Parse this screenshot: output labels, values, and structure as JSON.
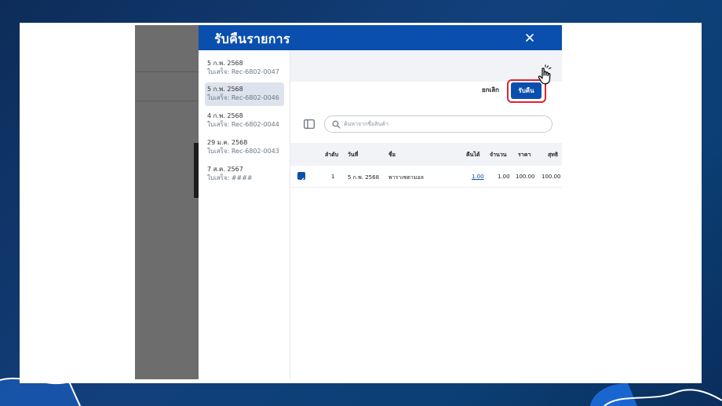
{
  "modal": {
    "title": "รับคืนรายการ"
  },
  "receipts": [
    {
      "date": "5 ก.พ. 2568",
      "receipt": "ใบเสร็จ: Rec-6802-0047",
      "selected": false
    },
    {
      "date": "5 ก.พ. 2568",
      "receipt": "ใบเสร็จ: Rec-6802-0046",
      "selected": true
    },
    {
      "date": "4 ก.พ. 2568",
      "receipt": "ใบเสร็จ: Rec-6802-0044",
      "selected": false
    },
    {
      "date": "29 ม.ค. 2568",
      "receipt": "ใบเสร็จ: Rec-6802-0043",
      "selected": false
    },
    {
      "date": "7 ส.ค. 2567",
      "receipt": "ใบเสร็จ: ####",
      "selected": false
    }
  ],
  "toolbar": {
    "cancel_label": "ยกเลิก",
    "confirm_label": "รับคืน"
  },
  "search": {
    "placeholder": "ค้นหาจากชื่อสินค้า"
  },
  "table": {
    "columns": [
      "ลำดับ",
      "วันที่",
      "ชื่อ",
      "คืนได้",
      "จำนวน",
      "ราคา",
      "สุทธิ"
    ],
    "rows": [
      {
        "checked": true,
        "index": "1",
        "date": "5 ก.พ. 2568",
        "name": "พาราเซตามอล",
        "returnable": "1.00",
        "qty": "1.00",
        "price": "100.00",
        "net": "100.00"
      }
    ]
  },
  "colors": {
    "primary": "#0a4fae",
    "highlight": "#e0242c",
    "selected_row": "#dde3ec"
  }
}
